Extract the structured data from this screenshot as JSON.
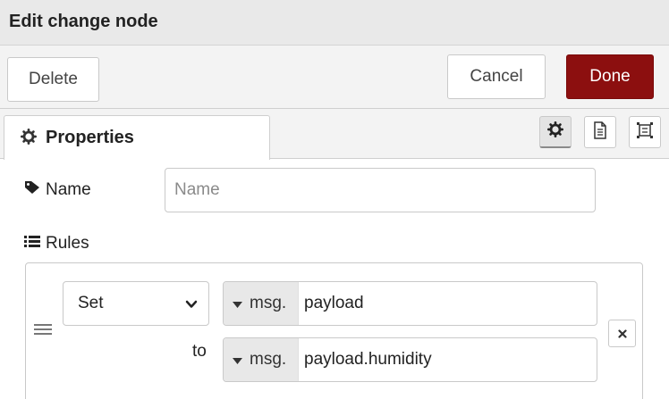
{
  "header": {
    "title": "Edit change node"
  },
  "toolbar": {
    "delete_label": "Delete",
    "cancel_label": "Cancel",
    "done_label": "Done"
  },
  "tabs": {
    "properties_label": "Properties"
  },
  "form": {
    "name_label": "Name",
    "name_placeholder": "Name",
    "name_value": "",
    "rules_label": "Rules"
  },
  "rules": [
    {
      "action": "Set",
      "target_type": "msg.",
      "target_value": "payload",
      "to_label": "to",
      "source_type": "msg.",
      "source_value": "payload.humidity"
    }
  ],
  "colors": {
    "done_button": "#8c0f0f",
    "header_bg": "#e9e9e9",
    "type_selector_bg": "#e8e8e8"
  }
}
